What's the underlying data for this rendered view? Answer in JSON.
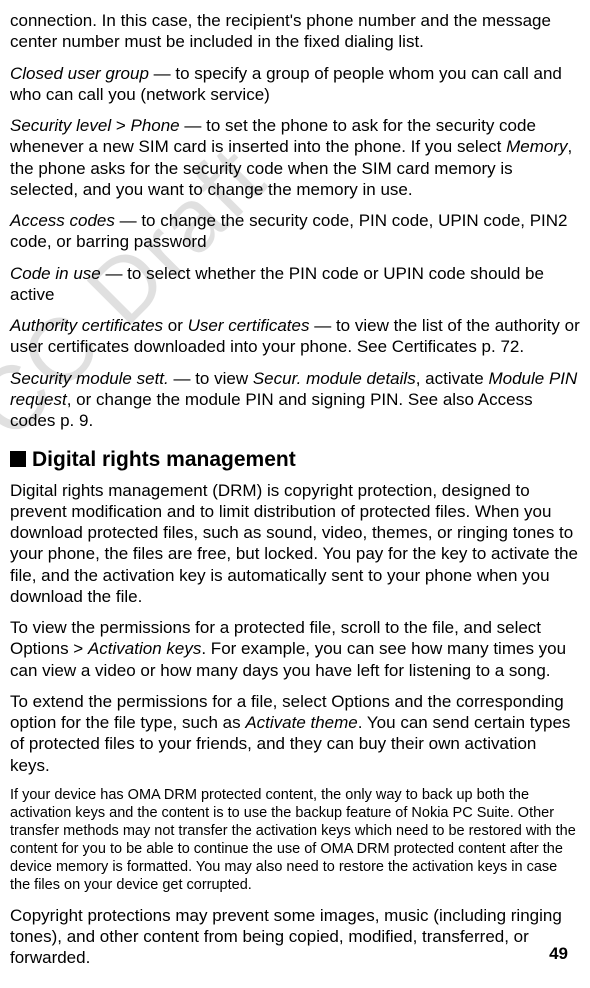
{
  "watermark": "FCC Draft",
  "p1": "connection. In this case, the recipient's phone number and the message center number must be included in the fixed dialing list.",
  "p2a": "Closed user group",
  "p2b": " — to specify a group of people whom you can call and who can call you (network service)",
  "p3a": "Security level",
  "p3b": " > ",
  "p3c": "Phone",
  "p3d": " — to set the phone to ask for the security code whenever a new SIM card is inserted into the phone. If you select ",
  "p3e": "Memory",
  "p3f": ", the phone asks for the security code when the SIM card memory is selected, and you want to change the memory in use.",
  "p4a": "Access codes",
  "p4b": " — to change the security code, PIN code, UPIN code, PIN2 code, or barring password",
  "p5a": "Code in use",
  "p5b": " — to select whether the PIN code or UPIN code should be active",
  "p6a": "Authority certificates",
  "p6b": " or ",
  "p6c": "User certificates",
  "p6d": " — to view the list of the authority or user certificates downloaded into your phone. See Certificates p. 72.",
  "p7a": "Security module sett.",
  "p7b": " — to view ",
  "p7c": "Secur. module details",
  "p7d": ", activate ",
  "p7e": "Module PIN request",
  "p7f": ", or change the module PIN and signing PIN. See also Access codes p. 9.",
  "heading": "Digital rights management",
  "p8": "Digital rights management (DRM) is copyright protection, designed to prevent modification and to limit distribution of protected files. When you download protected files, such as sound, video, themes, or ringing tones to your phone, the files are free, but locked. You pay for the key to activate the file, and the activation key is automatically sent to your phone when you download the file.",
  "p9a": "To view the permissions for a protected file, scroll to the file, and select Options > ",
  "p9b": "Activation keys",
  "p9c": ". For example, you can see how many times you can view a video or how many days you have left for listening to a song.",
  "p10a": "To extend the permissions for a file, select Options and the corresponding option for the file type, such as ",
  "p10b": "Activate theme",
  "p10c": ". You can send certain types of protected files to your friends, and they can buy their own activation keys.",
  "p11": "If your device has OMA DRM protected content, the only way to back up both the activation keys and the content is to use the backup feature of Nokia PC Suite. Other transfer methods may not transfer the activation keys which need to be restored with the content for you to be able to continue the use of OMA DRM protected content after the device memory is formatted. You may also need to restore the activation keys in case the files on your device get corrupted.",
  "p12": "Copyright protections may prevent some images, music (including ringing tones), and other content from being copied, modified, transferred, or forwarded.",
  "pageNumber": "49"
}
